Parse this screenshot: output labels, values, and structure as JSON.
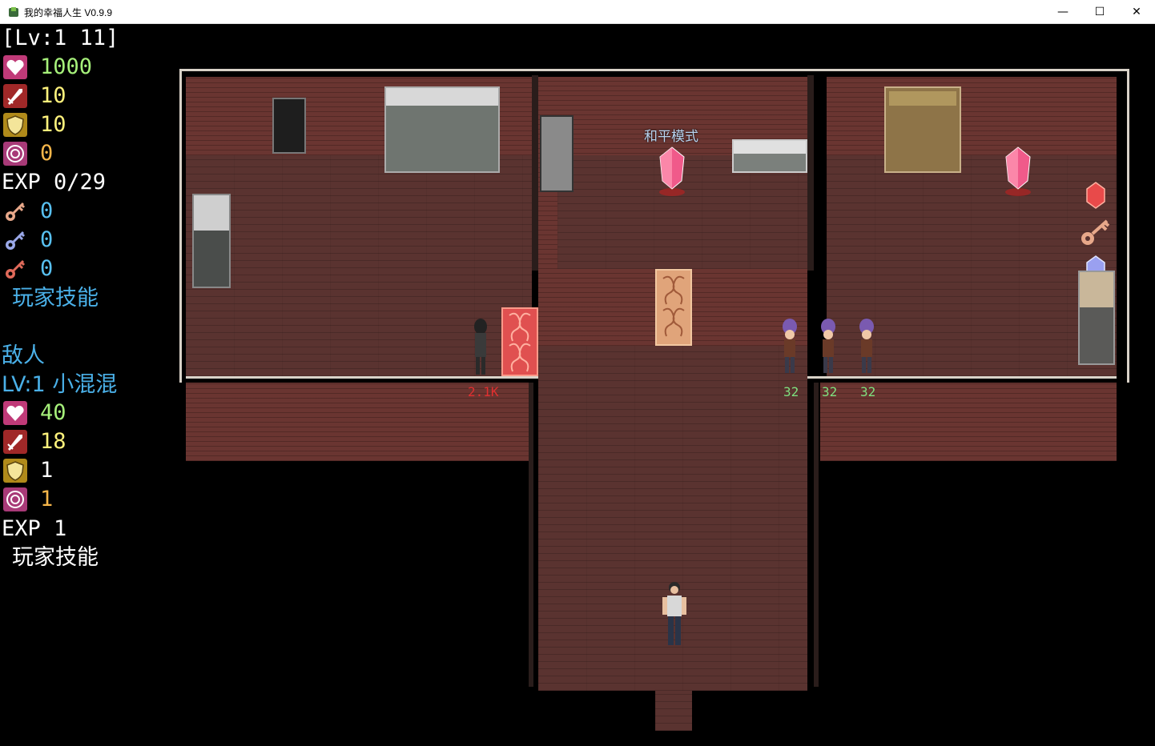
{
  "window": {
    "title": "我的幸福人生 V0.9.9",
    "minimize_glyph": "—",
    "maximize_glyph": "☐",
    "close_glyph": "✕"
  },
  "player": {
    "level_line": "[Lv:1 11]",
    "hp": "1000",
    "atk": "10",
    "def": "10",
    "magic": "0",
    "exp": "EXP 0/29",
    "key_yellow": "0",
    "key_blue": "0",
    "key_red": "0",
    "skills_label": "玩家技能"
  },
  "enemy": {
    "header": "敌人",
    "level_line": "LV:1 小混混",
    "hp": "40",
    "atk": "18",
    "def": "1",
    "magic": "1",
    "exp": "EXP  1",
    "skills_label": "玩家技能"
  },
  "map": {
    "mode_label": "和平模式",
    "boss_damage": "2.1K",
    "enemy_damage_1": "32",
    "enemy_damage_2": "32",
    "enemy_damage_3": "32"
  },
  "colors": {
    "hp_value": "#a6f07a",
    "atk_value": "#fff27c",
    "magic_value": "#f5b64a",
    "key_value": "#58c0f0",
    "skills": "#4ab0e8",
    "damage_red": "#e03030",
    "damage_green": "#7fe07f"
  },
  "icons": {
    "hp": "heart-icon",
    "atk": "sword-icon",
    "def": "shield-icon",
    "magic": "magic-circle-icon",
    "key_yellow": "yellow-key-icon",
    "key_blue": "blue-key-icon",
    "key_red": "red-key-icon"
  }
}
